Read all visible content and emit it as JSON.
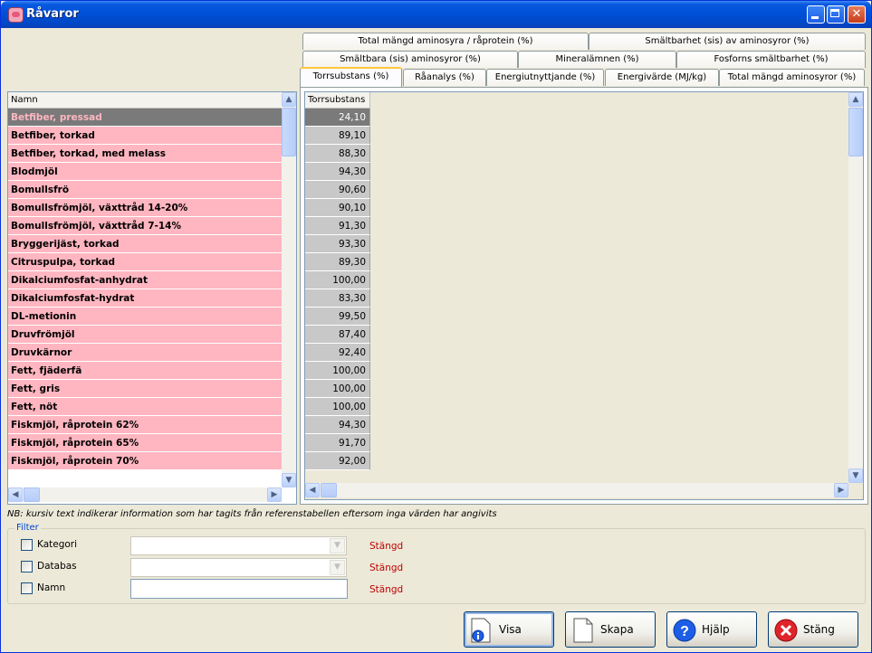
{
  "window": {
    "title": "Råvaror"
  },
  "tabs": {
    "row1": [
      "Total mängd aminosyra / råprotein (%)",
      "Smältbarhet (sis) av aminosyror (%)"
    ],
    "row2": [
      "Smältbara (sis) aminosyror (%)",
      "Mineralämnen (%)",
      "Fosforns smältbarhet (%)"
    ],
    "row3": [
      "Torrsubstans (%)",
      "Råanalys (%)",
      "Energiutnyttjande (%)",
      "Energivärde (MJ/kg)",
      "Total mängd aminosyror (%)"
    ],
    "active": "Torrsubstans (%)"
  },
  "list": {
    "header": "Namn",
    "selected_index": 0,
    "rows": [
      "Betfiber, pressad",
      "Betfiber, torkad",
      "Betfiber, torkad, med melass",
      "Blodmjöl",
      "Bomullsfrö",
      "Bomullsfrömjöl, växttråd 14-20%",
      "Bomullsfrömjöl, växttråd 7-14%",
      "Bryggerijäst, torkad",
      "Citruspulpa, torkad",
      "Dikalciumfosfat-anhydrat",
      "Dikalciumfosfat-hydrat",
      "DL-metionin",
      "Druvfrömjöl",
      "Druvkärnor",
      "Fett, fjäderfä",
      "Fett, gris",
      "Fett, nöt",
      "Fiskmjöl, råprotein 62%",
      "Fiskmjöl, råprotein 65%",
      "Fiskmjöl, råprotein 70%"
    ]
  },
  "grid": {
    "column": "Torrsubstans",
    "values": [
      "24,10",
      "89,10",
      "88,30",
      "94,30",
      "90,60",
      "90,10",
      "91,30",
      "93,30",
      "89,30",
      "100,00",
      "83,30",
      "99,50",
      "87,40",
      "92,40",
      "100,00",
      "100,00",
      "100,00",
      "94,30",
      "91,70",
      "92,00"
    ]
  },
  "note": "NB: kursiv text indikerar information som har tagits från referenstabellen eftersom inga värden har angivits",
  "filter": {
    "legend": "Filter",
    "kategori_label": "Kategori",
    "databas_label": "Databas",
    "namn_label": "Namn",
    "kategori_status": "Stängd",
    "databas_status": "Stängd",
    "namn_status": "Stängd",
    "namn_value": ""
  },
  "buttons": {
    "visa": "Visa",
    "skapa": "Skapa",
    "hjalp": "Hjälp",
    "stang": "Stäng"
  },
  "colors": {
    "row_pink": "#ffb6c1",
    "selected_gray": "#7a7a7a",
    "status_red": "#c00000",
    "titlebar_blue": "#0050d8"
  }
}
